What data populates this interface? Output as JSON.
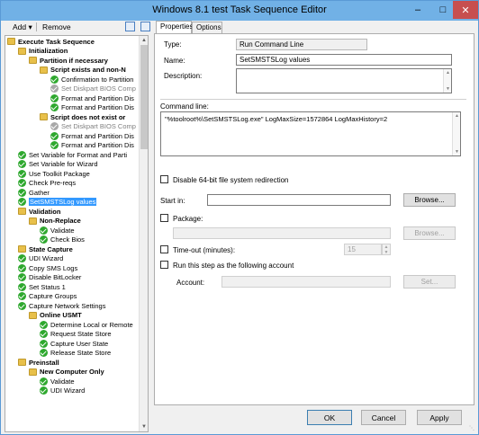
{
  "window": {
    "title": "Windows 8.1 test Task Sequence Editor"
  },
  "toolbar": {
    "add_label": "Add",
    "remove_label": "Remove"
  },
  "tree": {
    "items": [
      {
        "label": "Execute Task Sequence",
        "depth": 0,
        "kind": "folder",
        "bold": true
      },
      {
        "label": "Initialization",
        "depth": 1,
        "kind": "folder",
        "bold": true
      },
      {
        "label": "Partition if necessary",
        "depth": 2,
        "kind": "folder",
        "bold": true
      },
      {
        "label": "Script exists and non-N",
        "depth": 3,
        "kind": "folder",
        "bold": true
      },
      {
        "label": "Confirmation to Partition",
        "depth": 4,
        "kind": "check"
      },
      {
        "label": "Set Diskpart BIOS Comp",
        "depth": 4,
        "kind": "check-gray"
      },
      {
        "label": "Format and Partition Dis",
        "depth": 4,
        "kind": "check"
      },
      {
        "label": "Format and Partition Dis",
        "depth": 4,
        "kind": "check"
      },
      {
        "label": "Script does not exist or",
        "depth": 3,
        "kind": "folder",
        "bold": true
      },
      {
        "label": "Set Diskpart BIOS Comp",
        "depth": 4,
        "kind": "check-gray"
      },
      {
        "label": "Format and Partition Dis",
        "depth": 4,
        "kind": "check"
      },
      {
        "label": "Format and Partition Dis",
        "depth": 4,
        "kind": "check"
      },
      {
        "label": "Set Variable for Format and Parti",
        "depth": 1,
        "kind": "check"
      },
      {
        "label": "Set Variable for Wizard",
        "depth": 1,
        "kind": "check"
      },
      {
        "label": "Use Toolkit Package",
        "depth": 1,
        "kind": "check"
      },
      {
        "label": "Check Pre-reqs",
        "depth": 1,
        "kind": "check"
      },
      {
        "label": "Gather",
        "depth": 1,
        "kind": "check"
      },
      {
        "label": "SetSMSTSLog values",
        "depth": 1,
        "kind": "check",
        "selected": true
      },
      {
        "label": "Validation",
        "depth": 0,
        "kind": "folder",
        "bold": true,
        "indent": 1
      },
      {
        "label": "Non-Replace",
        "depth": 1,
        "kind": "folder",
        "bold": true,
        "indent": 2
      },
      {
        "label": "Validate",
        "depth": 2,
        "kind": "check",
        "indent": 3
      },
      {
        "label": "Check Bios",
        "depth": 2,
        "kind": "check",
        "indent": 3
      },
      {
        "label": "State Capture",
        "depth": 0,
        "kind": "folder",
        "bold": true,
        "indent": 1
      },
      {
        "label": "UDI Wizard",
        "depth": 1,
        "kind": "check"
      },
      {
        "label": "Copy SMS Logs",
        "depth": 1,
        "kind": "check"
      },
      {
        "label": "Disable BitLocker",
        "depth": 1,
        "kind": "check"
      },
      {
        "label": "Set Status 1",
        "depth": 1,
        "kind": "check"
      },
      {
        "label": "Capture Groups",
        "depth": 1,
        "kind": "check"
      },
      {
        "label": "Capture Network Settings",
        "depth": 1,
        "kind": "check"
      },
      {
        "label": "Online USMT",
        "depth": 1,
        "kind": "folder",
        "bold": true,
        "indent": 2
      },
      {
        "label": "Determine Local or Remote",
        "depth": 2,
        "kind": "check",
        "indent": 3
      },
      {
        "label": "Request State Store",
        "depth": 2,
        "kind": "check",
        "indent": 3
      },
      {
        "label": "Capture User State",
        "depth": 2,
        "kind": "check",
        "indent": 3
      },
      {
        "label": "Release State Store",
        "depth": 2,
        "kind": "check",
        "indent": 3
      },
      {
        "label": "Preinstall",
        "depth": 0,
        "kind": "folder",
        "bold": true,
        "indent": 1
      },
      {
        "label": "New Computer Only",
        "depth": 1,
        "kind": "folder",
        "bold": true,
        "indent": 2
      },
      {
        "label": "Validate",
        "depth": 2,
        "kind": "check",
        "indent": 3
      },
      {
        "label": "UDI Wizard",
        "depth": 2,
        "kind": "check",
        "indent": 3
      }
    ]
  },
  "tabs": {
    "properties": "Properties",
    "options": "Options"
  },
  "props": {
    "type_label": "Type:",
    "type_value": "Run Command Line",
    "name_label": "Name:",
    "name_value": "SetSMSTSLog values",
    "description_label": "Description:",
    "command_line_label": "Command line:",
    "command_line_value": "\"%toolroot%\\SetSMSTSLog.exe\" LogMaxSize=1572864 LogMaxHistory=2",
    "disable64_label": "Disable 64-bit file system redirection",
    "start_in_label": "Start in:",
    "browse_label": "Browse...",
    "package_label": "Package:",
    "browse2_label": "Browse...",
    "timeout_label": "Time-out (minutes):",
    "timeout_value": "15",
    "run_as_label": "Run this step as the following account",
    "account_label": "Account:",
    "set_label": "Set..."
  },
  "buttons": {
    "ok": "OK",
    "cancel": "Cancel",
    "apply": "Apply"
  },
  "colors": {
    "titlebar": "#71b1e6",
    "selection": "#3399ff",
    "check": "#2ea82e",
    "folder": "#e8c04a"
  }
}
